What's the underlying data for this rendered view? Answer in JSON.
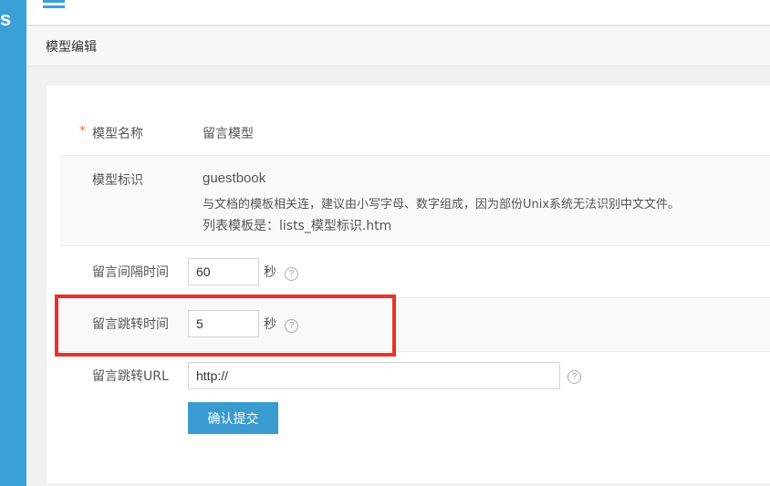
{
  "sidebar": {
    "logo_fragment": "s"
  },
  "header": {
    "menu_icon": "hamburger-menu-icon"
  },
  "breadcrumb": {
    "title": "模型编辑"
  },
  "form": {
    "model_name": {
      "label": "模型名称",
      "required_mark": "*",
      "value": "留言模型"
    },
    "model_id": {
      "label": "模型标识",
      "value": "guestbook",
      "hint1": "与文档的模板相关连，建议由小写字母、数字组成，因为部份Unix系统无法识别中文文件。",
      "hint2": "列表模板是：lists_模型标识.htm"
    },
    "interval": {
      "label": "留言间隔时间",
      "value": "60",
      "unit": "秒",
      "help": "?"
    },
    "jump_time": {
      "label": "留言跳转时间",
      "value": "5",
      "unit": "秒",
      "help": "?"
    },
    "jump_url": {
      "label": "留言跳转URL",
      "value": "http://",
      "help": "?"
    },
    "submit_label": "确认提交"
  },
  "colors": {
    "accent": "#3aa0d6",
    "button": "#3a9bd1",
    "highlight": "#e8322b",
    "required": "#f0783c"
  }
}
